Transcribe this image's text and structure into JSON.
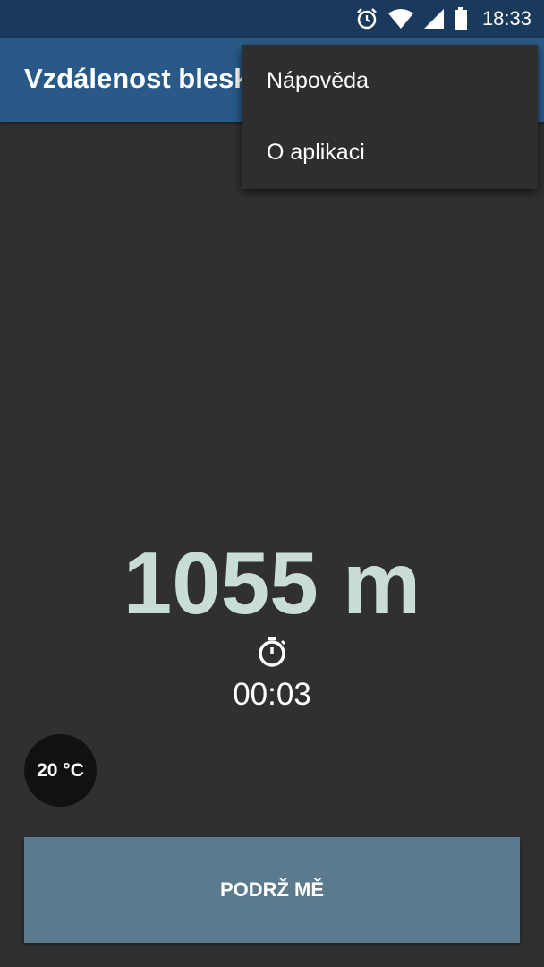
{
  "status_bar": {
    "time": "18:33",
    "icons": [
      "alarm-icon",
      "wifi-icon",
      "cellular-signal-icon",
      "battery-icon"
    ]
  },
  "app_bar": {
    "title": "Vzdálenost blesku"
  },
  "overflow_menu": {
    "items": [
      {
        "label": "Nápověda"
      },
      {
        "label": "O aplikaci"
      }
    ]
  },
  "main": {
    "distance": "1055 m",
    "timer_icon": "stopwatch-icon",
    "timer": "00:03",
    "temperature": "20 °C",
    "hold_button_label": "PODRŽ MĚ"
  },
  "colors": {
    "status_bar": "#1a3a5c",
    "app_bar": "#295a87",
    "background": "#303030",
    "distance_text": "#c8dcd8",
    "button": "#5b7a8e"
  }
}
